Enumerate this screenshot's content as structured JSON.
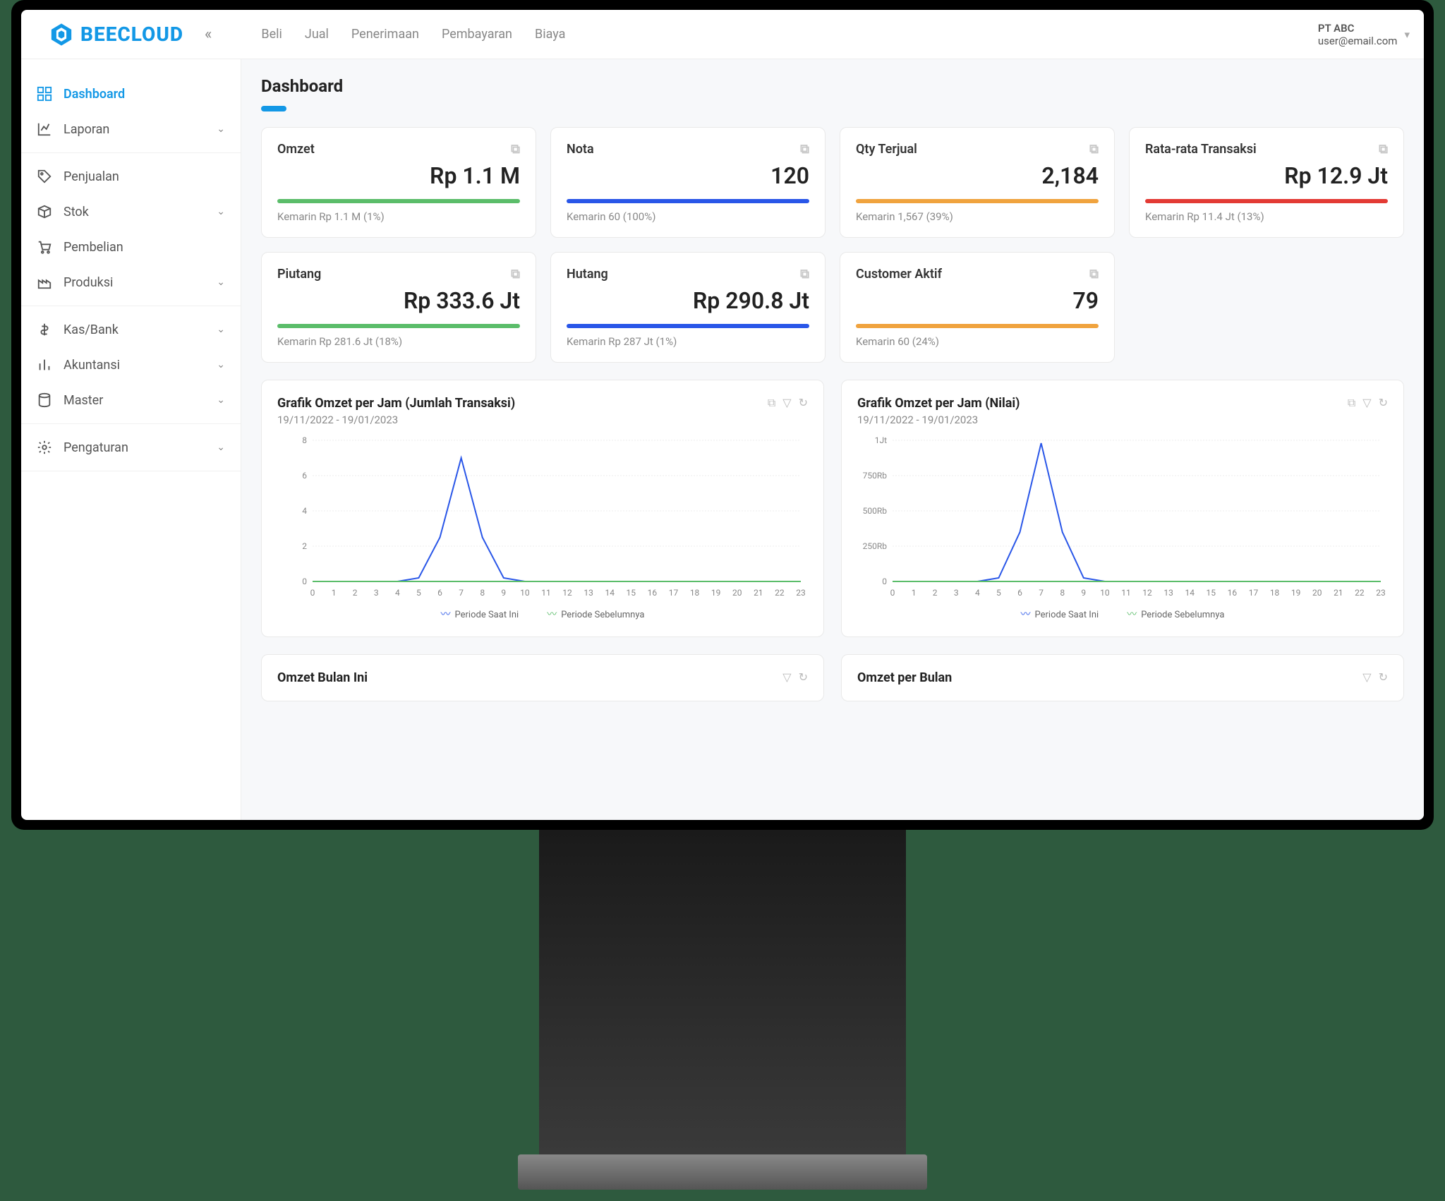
{
  "logo": {
    "text": "BEECLOUD"
  },
  "top_nav": [
    "Beli",
    "Jual",
    "Penerimaan",
    "Pembayaran",
    "Biaya"
  ],
  "user": {
    "company": "PT ABC",
    "email": "user@email.com"
  },
  "sidebar": [
    {
      "label": "Dashboard",
      "icon": "grid",
      "active": true,
      "expand": false
    },
    {
      "label": "Laporan",
      "icon": "chart",
      "expand": true
    },
    {
      "_divider": true
    },
    {
      "label": "Penjualan",
      "icon": "tag",
      "expand": false
    },
    {
      "label": "Stok",
      "icon": "box",
      "expand": true
    },
    {
      "label": "Pembelian",
      "icon": "cart",
      "expand": false
    },
    {
      "label": "Produksi",
      "icon": "factory",
      "expand": true
    },
    {
      "_divider": true
    },
    {
      "label": "Kas/Bank",
      "icon": "dollar",
      "expand": true
    },
    {
      "label": "Akuntansi",
      "icon": "bars",
      "expand": true
    },
    {
      "label": "Master",
      "icon": "db",
      "expand": true
    },
    {
      "_divider": true
    },
    {
      "label": "Pengaturan",
      "icon": "gear",
      "expand": true
    }
  ],
  "page_title": "Dashboard",
  "cards": [
    {
      "title": "Omzet",
      "value": "Rp 1.1 M",
      "bar": "green",
      "sub": "Kemarin Rp 1.1 M (1%)"
    },
    {
      "title": "Nota",
      "value": "120",
      "bar": "blue",
      "sub": "Kemarin 60 (100%)"
    },
    {
      "title": "Qty Terjual",
      "value": "2,184",
      "bar": "orange",
      "sub": "Kemarin 1,567 (39%)"
    },
    {
      "title": "Rata-rata Transaksi",
      "value": "Rp 12.9 Jt",
      "bar": "red",
      "sub": "Kemarin Rp 11.4 Jt (13%)"
    },
    {
      "title": "Piutang",
      "value": "Rp 333.6 Jt",
      "bar": "green",
      "sub": "Kemarin Rp 281.6 Jt (18%)"
    },
    {
      "title": "Hutang",
      "value": "Rp 290.8 Jt",
      "bar": "blue",
      "sub": "Kemarin Rp 287 Jt (1%)"
    },
    {
      "title": "Customer Aktif",
      "value": "79",
      "bar": "orange",
      "sub": "Kemarin 60 (24%)"
    }
  ],
  "chart1": {
    "title": "Grafik Omzet per Jam (Jumlah Transaksi)",
    "range": "19/11/2022 - 19/01/2023",
    "legend_current": "Periode Saat Ini",
    "legend_prev": "Periode Sebelumnya"
  },
  "chart2": {
    "title": "Grafik Omzet per Jam (Nilai)",
    "range": "19/11/2022 - 19/01/2023",
    "legend_current": "Periode Saat Ini",
    "legend_prev": "Periode Sebelumnya"
  },
  "small1": {
    "title": "Omzet Bulan Ini"
  },
  "small2": {
    "title": "Omzet per Bulan"
  },
  "chart_data": [
    {
      "type": "line",
      "title": "Grafik Omzet per Jam (Jumlah Transaksi)",
      "xlabel": "",
      "ylabel": "",
      "x": [
        0,
        1,
        2,
        3,
        4,
        5,
        6,
        7,
        8,
        9,
        10,
        11,
        12,
        13,
        14,
        15,
        16,
        17,
        18,
        19,
        20,
        21,
        22,
        23
      ],
      "series": [
        {
          "name": "Periode Saat Ini",
          "values": [
            0,
            0,
            0,
            0,
            0,
            0.2,
            2.5,
            7,
            2.5,
            0.2,
            0,
            0,
            0,
            0,
            0,
            0,
            0,
            0,
            0,
            0,
            0,
            0,
            0,
            0
          ]
        },
        {
          "name": "Periode Sebelumnya",
          "values": [
            0,
            0,
            0,
            0,
            0,
            0,
            0,
            0,
            0,
            0,
            0,
            0,
            0,
            0,
            0,
            0,
            0,
            0,
            0,
            0,
            0,
            0,
            0,
            0
          ]
        }
      ],
      "yticks": [
        0,
        2,
        4,
        6,
        8
      ],
      "ylim": [
        0,
        8
      ]
    },
    {
      "type": "line",
      "title": "Grafik Omzet per Jam (Nilai)",
      "xlabel": "",
      "ylabel": "",
      "x": [
        0,
        1,
        2,
        3,
        4,
        5,
        6,
        7,
        8,
        9,
        10,
        11,
        12,
        13,
        14,
        15,
        16,
        17,
        18,
        19,
        20,
        21,
        22,
        23
      ],
      "series": [
        {
          "name": "Periode Saat Ini",
          "values": [
            0,
            0,
            0,
            0,
            0,
            25000,
            350000,
            980000,
            350000,
            25000,
            0,
            0,
            0,
            0,
            0,
            0,
            0,
            0,
            0,
            0,
            0,
            0,
            0,
            0
          ]
        },
        {
          "name": "Periode Sebelumnya",
          "values": [
            0,
            0,
            0,
            0,
            0,
            0,
            0,
            0,
            0,
            0,
            0,
            0,
            0,
            0,
            0,
            0,
            0,
            0,
            0,
            0,
            0,
            0,
            0,
            0
          ]
        }
      ],
      "ytick_labels": [
        "0",
        "250Rb",
        "500Rb",
        "750Rb",
        "1Jt"
      ],
      "yticks": [
        0,
        250000,
        500000,
        750000,
        1000000
      ],
      "ylim": [
        0,
        1000000
      ]
    }
  ]
}
